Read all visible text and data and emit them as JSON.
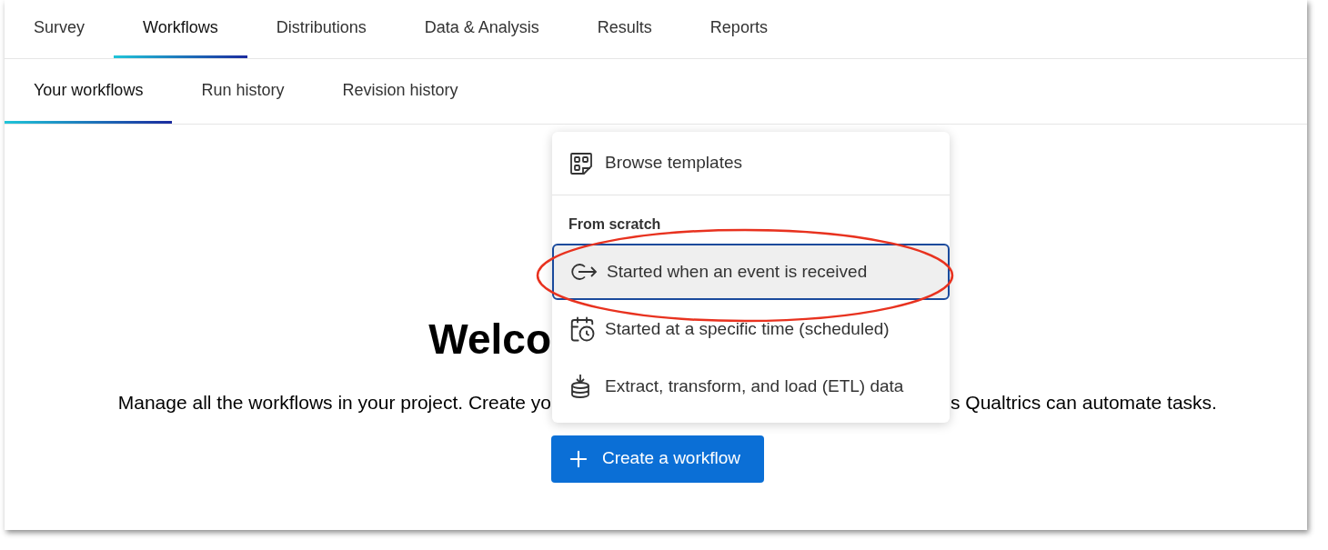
{
  "primary_tabs": [
    {
      "label": "Survey",
      "selected": false
    },
    {
      "label": "Workflows",
      "selected": true
    },
    {
      "label": "Distributions",
      "selected": false
    },
    {
      "label": "Data & Analysis",
      "selected": false
    },
    {
      "label": "Results",
      "selected": false
    },
    {
      "label": "Reports",
      "selected": false
    }
  ],
  "secondary_tabs": [
    {
      "label": "Your workflows",
      "selected": true
    },
    {
      "label": "Run history",
      "selected": false
    },
    {
      "label": "Revision history",
      "selected": false
    }
  ],
  "welcome": {
    "heading": "Welco",
    "description_left": "Manage all the workflows in your project. Create yo",
    "description_right": "s Qualtrics can automate tasks."
  },
  "create_button": {
    "label": "Create a workflow"
  },
  "dropdown": {
    "items": [
      {
        "kind": "template",
        "label": "Browse templates",
        "selected": false
      },
      {
        "kind": "header",
        "label": "From scratch"
      },
      {
        "kind": "event",
        "label": "Started when an event is received",
        "selected": true
      },
      {
        "kind": "schedule",
        "label": "Started at a specific time (scheduled)",
        "selected": false
      },
      {
        "kind": "etl",
        "label": "Extract, transform, and load (ETL) data",
        "selected": false
      }
    ]
  }
}
